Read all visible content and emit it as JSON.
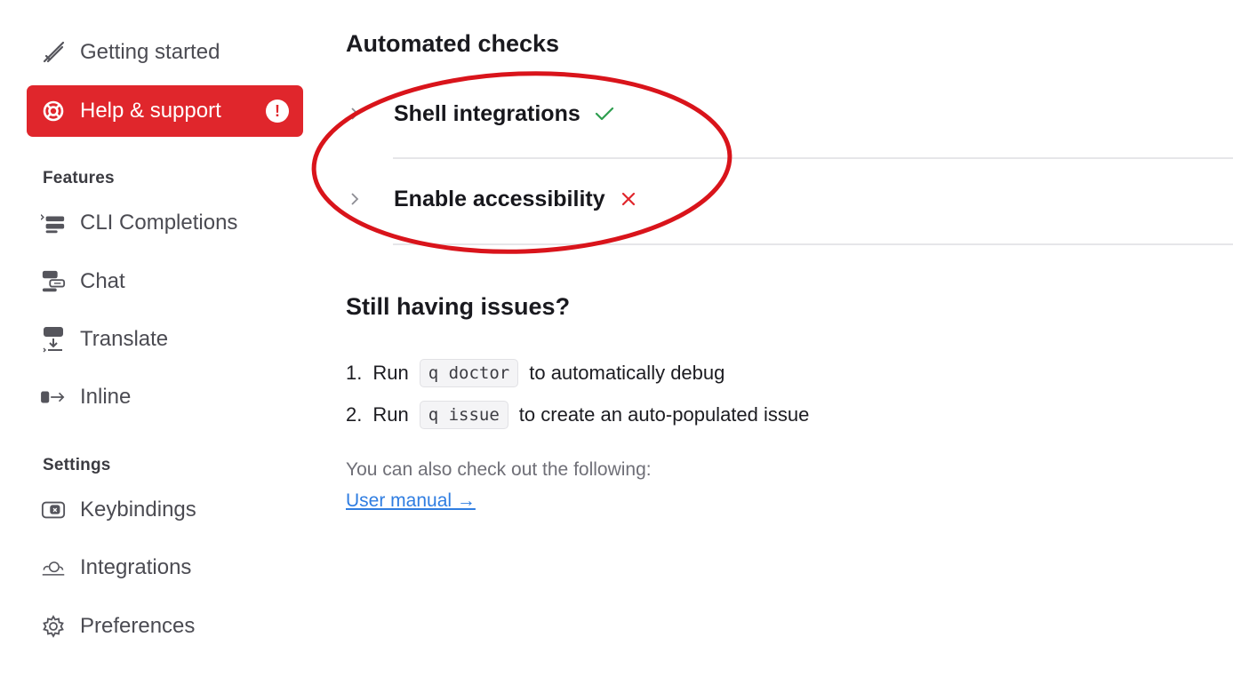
{
  "sidebar": {
    "items": [
      {
        "label": "Getting started",
        "icon": "rocket-icon"
      },
      {
        "label": "Help & support",
        "icon": "lifebuoy-icon",
        "badge": "!"
      },
      {
        "label": "CLI Completions",
        "icon": "cli-completions-icon"
      },
      {
        "label": "Chat",
        "icon": "chat-icon"
      },
      {
        "label": "Translate",
        "icon": "translate-icon"
      },
      {
        "label": "Inline",
        "icon": "inline-icon"
      },
      {
        "label": "Keybindings",
        "icon": "keyboard-icon"
      },
      {
        "label": "Integrations",
        "icon": "integrations-icon"
      },
      {
        "label": "Preferences",
        "icon": "gear-icon"
      }
    ],
    "sections": {
      "features": "Features",
      "settings": "Settings"
    }
  },
  "main": {
    "automated_checks": {
      "title": "Automated checks",
      "items": [
        {
          "label": "Shell integrations",
          "status": "pass"
        },
        {
          "label": "Enable accessibility",
          "status": "fail"
        }
      ]
    },
    "issues": {
      "title": "Still having issues?",
      "steps": [
        {
          "num": "1.",
          "prefix": "Run",
          "code": "q doctor",
          "suffix": "to automatically debug"
        },
        {
          "num": "2.",
          "prefix": "Run",
          "code": "q issue",
          "suffix": "to create an auto-populated issue"
        }
      ],
      "also_text": "You can also check out the following:",
      "link_label": "User manual →"
    }
  },
  "colors": {
    "accent": "#e0262c",
    "pass": "#2e9e4f",
    "fail": "#e0262c",
    "link": "#2f7de1",
    "annotation": "#d9141b"
  }
}
